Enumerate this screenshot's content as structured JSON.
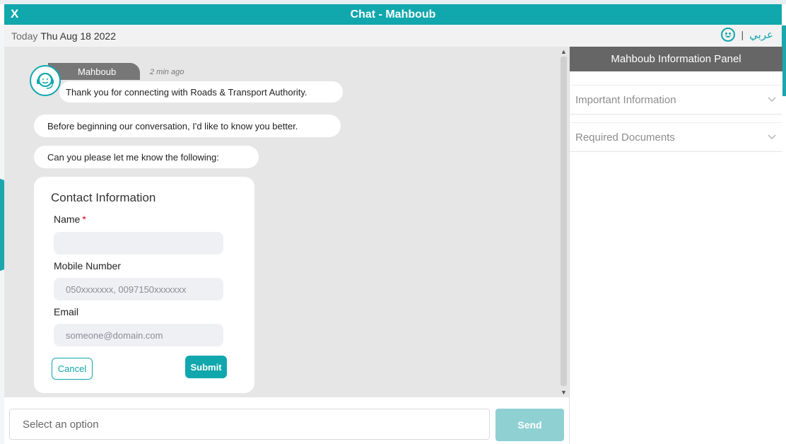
{
  "window": {
    "title": "Chat - Mahboub",
    "close_label": "X"
  },
  "subbar": {
    "today_label": "Today",
    "date": "Thu Aug 18 2022",
    "divider": "|",
    "language_link": "عربي"
  },
  "conversation": {
    "agent_name": "Mahboub",
    "timestamp": "2 min ago",
    "messages": [
      "Thank you for connecting with Roads & Transport Authority.",
      "Before beginning our conversation, I'd like to know you better.",
      "Can you please let me know the following:"
    ]
  },
  "contact_form": {
    "title": "Contact Information",
    "name_label": "Name",
    "required_mark": "*",
    "name_value": "",
    "mobile_label": "Mobile Number",
    "mobile_placeholder": "050xxxxxxx, 0097150xxxxxxx",
    "email_label": "Email",
    "email_placeholder": "someone@domain.com",
    "cancel_label": "Cancel",
    "submit_label": "Submit"
  },
  "input_bar": {
    "placeholder": "Select an option",
    "send_label": "Send"
  },
  "info_panel": {
    "title": "Mahboub Information Panel",
    "sections": [
      "Important Information",
      "Required Documents"
    ]
  },
  "colors": {
    "brand_teal": "#10a7ad",
    "send_disabled": "#8fd0d3",
    "panel_header": "#666666",
    "conversation_bg": "#e6e6e6"
  },
  "icons": {
    "close": "close-icon",
    "feedback": "smiley-icon",
    "avatar": "agent-headset-icon",
    "accordion": "chevron-down-icon"
  }
}
